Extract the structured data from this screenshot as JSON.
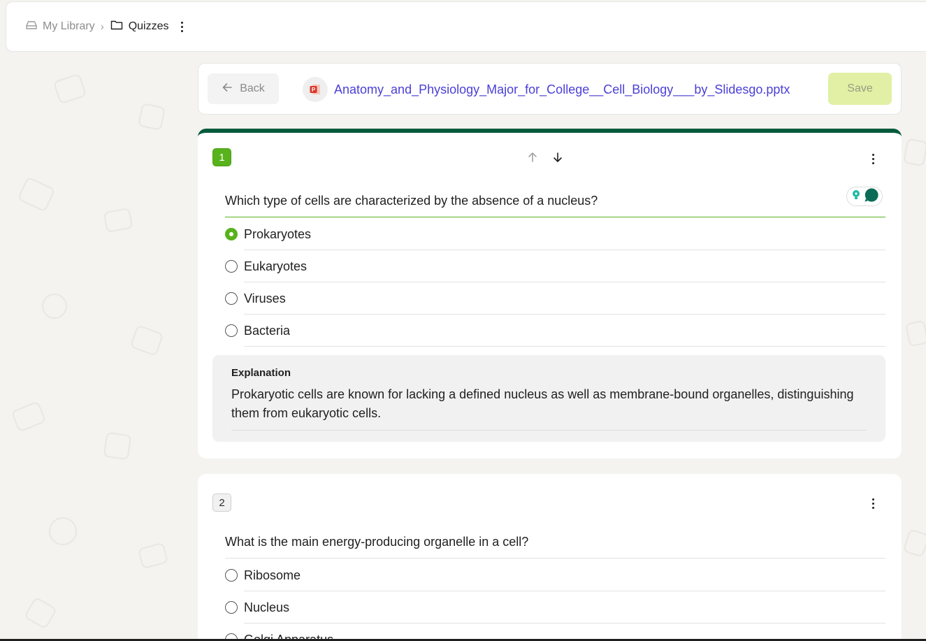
{
  "breadcrumb": {
    "library_label": "My Library",
    "separator": "›",
    "current_label": "Quizzes"
  },
  "filebar": {
    "back_label": "Back",
    "file_name": "Anatomy_and_Physiology_Major_for_College__Cell_Biology___by_Slidesgo.pptx",
    "file_icon": "powerpoint-file-icon",
    "save_label": "Save"
  },
  "questions": [
    {
      "number": "1",
      "text": "Which type of cells are characterized by the absence of a nucleus?",
      "options": [
        {
          "label": "Prokaryotes",
          "selected": true
        },
        {
          "label": "Eukaryotes",
          "selected": false
        },
        {
          "label": "Viruses",
          "selected": false
        },
        {
          "label": "Bacteria",
          "selected": false
        }
      ],
      "explanation_title": "Explanation",
      "explanation_text": "Prokaryotic cells are known for lacking a defined nucleus as well as membrane-bound organelles, distinguishing them from eukaryotic cells."
    },
    {
      "number": "2",
      "text": "What is the main energy-producing organelle in a cell?",
      "options": [
        {
          "label": "Ribosome",
          "selected": false
        },
        {
          "label": "Nucleus",
          "selected": false
        },
        {
          "label": "Golgi Apparatus",
          "selected": false
        }
      ]
    }
  ],
  "colors": {
    "accent_green": "#58b21b",
    "card_top_bar": "#045a3c",
    "file_link": "#4a3fd6",
    "save_bg": "#e1f0a5"
  }
}
